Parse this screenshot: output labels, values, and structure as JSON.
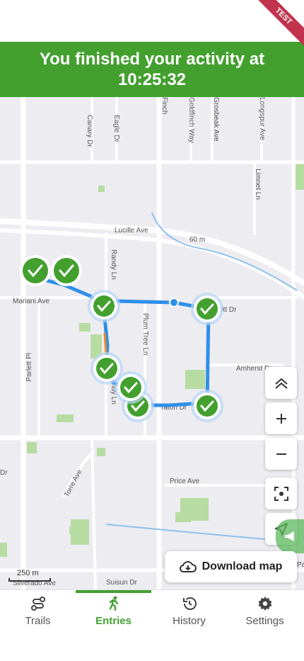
{
  "test_ribbon": "TEST",
  "banner": {
    "message": "You finished your activity at 10:25:32"
  },
  "map": {
    "scale_label": "250 m",
    "street_labels": {
      "lucille": "Lucille Ave",
      "mariani": "Mariani Ave",
      "amherst": "Amherst Dr",
      "price": "Price Ave",
      "suisun": "Suisun Dr",
      "silverado": "Silverado Ave",
      "torre": "Torre Ave",
      "plum_tree": "Plum Tree Ln",
      "randy": "Randy Ln",
      "canary": "Canary Dr",
      "eagle": "Eagle Dr",
      "finch": "Finch",
      "goldfinch": "Goldfinch Way",
      "grosbeak": "Grosbeak Ave",
      "longspur": "Longspur Ave",
      "limnet": "Limnet Ln",
      "parlett": "Parlett Pl",
      "dr_left": "Dr",
      "elliott": "ott Dr",
      "sheraton": "raton Dr",
      "road_60": "60 m",
      "park": "Park"
    }
  },
  "controls": {
    "download_label": "Download map"
  },
  "nav": {
    "items": [
      {
        "label": "Trails",
        "icon": "trails-icon"
      },
      {
        "label": "Entries",
        "icon": "running-person-icon",
        "active": true
      },
      {
        "label": "History",
        "icon": "history-clock-icon"
      },
      {
        "label": "Settings",
        "icon": "gear-icon"
      }
    ]
  },
  "colors": {
    "brand_green": "#43a02f",
    "route_blue": "#2f8fe8",
    "ribbon": "#c2334d"
  }
}
